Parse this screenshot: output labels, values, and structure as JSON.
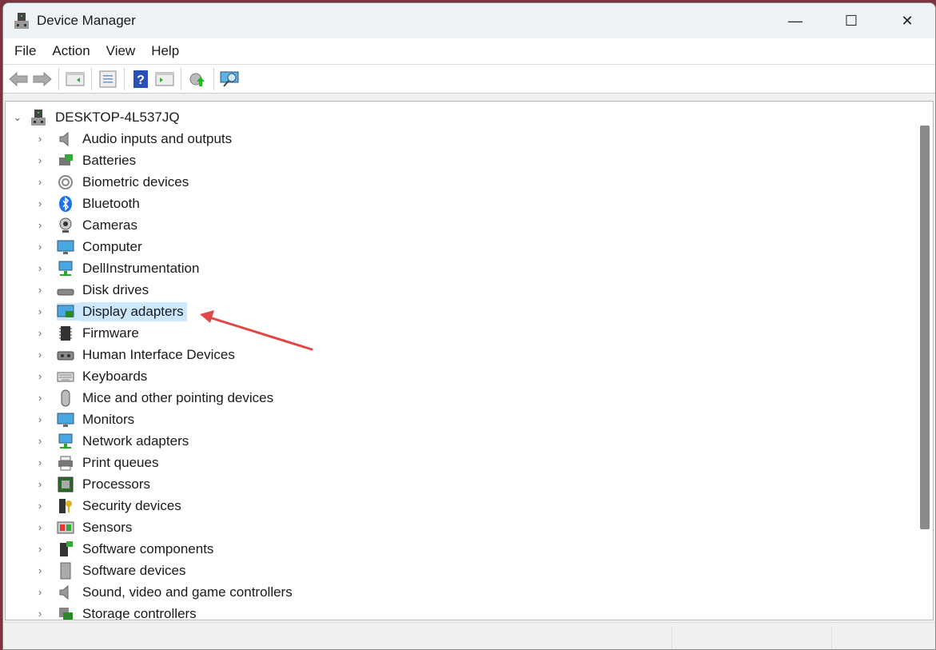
{
  "window": {
    "title": "Device Manager",
    "icon": "device-manager-icon"
  },
  "window_controls": {
    "minimize": "—",
    "maximize": "☐",
    "close": "✕"
  },
  "menu": [
    "File",
    "Action",
    "View",
    "Help"
  ],
  "toolbar": [
    "back",
    "forward",
    "show-hide-console-tree",
    "properties",
    "help",
    "show-hide-action-pane",
    "update-driver",
    "scan-hardware-changes"
  ],
  "tree": {
    "root": "DESKTOP-4L537JQ",
    "selected": "Display adapters",
    "items": [
      {
        "label": "Audio inputs and outputs",
        "icon": "speaker"
      },
      {
        "label": "Batteries",
        "icon": "battery"
      },
      {
        "label": "Biometric devices",
        "icon": "fingerprint"
      },
      {
        "label": "Bluetooth",
        "icon": "bluetooth"
      },
      {
        "label": "Cameras",
        "icon": "camera"
      },
      {
        "label": "Computer",
        "icon": "monitor"
      },
      {
        "label": "DellInstrumentation",
        "icon": "network"
      },
      {
        "label": "Disk drives",
        "icon": "disk"
      },
      {
        "label": "Display adapters",
        "icon": "display-adapter"
      },
      {
        "label": "Firmware",
        "icon": "chip"
      },
      {
        "label": "Human Interface Devices",
        "icon": "hid"
      },
      {
        "label": "Keyboards",
        "icon": "keyboard"
      },
      {
        "label": "Mice and other pointing devices",
        "icon": "mouse"
      },
      {
        "label": "Monitors",
        "icon": "monitor"
      },
      {
        "label": "Network adapters",
        "icon": "network"
      },
      {
        "label": "Print queues",
        "icon": "printer"
      },
      {
        "label": "Processors",
        "icon": "processor"
      },
      {
        "label": "Security devices",
        "icon": "security"
      },
      {
        "label": "Sensors",
        "icon": "sensor"
      },
      {
        "label": "Software components",
        "icon": "software"
      },
      {
        "label": "Software devices",
        "icon": "software-device"
      },
      {
        "label": "Sound, video and game controllers",
        "icon": "speaker"
      },
      {
        "label": "Storage controllers",
        "icon": "storage"
      }
    ]
  },
  "colors": {
    "accent_arrow": "#e04848",
    "selection": "#cce8ff"
  }
}
